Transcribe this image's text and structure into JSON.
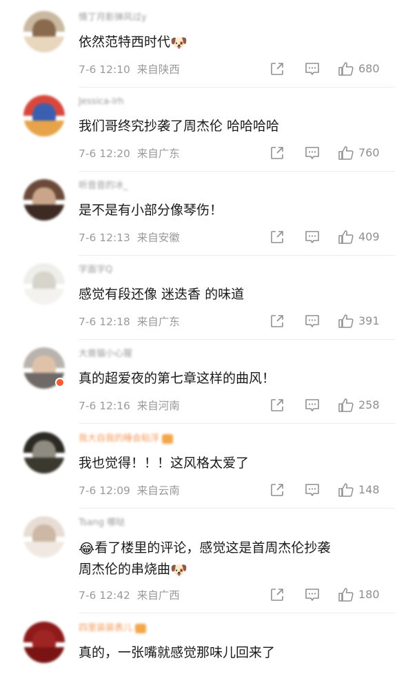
{
  "comments": [
    {
      "username": "情丁月影弹风过y",
      "text": "依然范特西时代",
      "emoji_after": "🐶",
      "time": "7-6 12:10",
      "location": "来自陕西",
      "likes": "680",
      "avatar_colors": [
        "#c9b9a0",
        "#8a6a4c",
        "#e8d6bd"
      ]
    },
    {
      "username": "Jessica-lrh",
      "text": "我们哥终究抄袭了周杰伦 哈哈哈哈",
      "time": "7-6 12:20",
      "location": "来自广东",
      "likes": "760",
      "avatar_colors": [
        "#d8473c",
        "#3a5fb0",
        "#e6a34a"
      ]
    },
    {
      "username": "听音音的冰_",
      "text": "是不是有小部分像琴伤！",
      "time": "7-6 12:13",
      "location": "来自安徽",
      "likes": "409",
      "avatar_colors": [
        "#6b4a3a",
        "#caa58a",
        "#3d2a22"
      ]
    },
    {
      "username": "字面字Q",
      "text": "感觉有段还像 迷迭香 的味道",
      "time": "7-6 12:18",
      "location": "来自广东",
      "likes": "391",
      "avatar_colors": [
        "#eeeeea",
        "#d7d4cc",
        "#f3f2ee"
      ]
    },
    {
      "username": "大兽猫小心猩",
      "text": "真的超爱夜的第七章这样的曲风！",
      "time": "7-6 12:16",
      "location": "来自河南",
      "likes": "258",
      "avatar_colors": [
        "#b9b3ae",
        "#e0c2a8",
        "#6f6a68"
      ]
    },
    {
      "username": "我大自我的睡会粘浮",
      "text": "我也觉得！！！这风格太爱了",
      "time": "7-6 12:09",
      "location": "来自云南",
      "likes": "148",
      "avatar_colors": [
        "#2c2a24",
        "#8f8b80",
        "#3a382f"
      ]
    },
    {
      "username": "Tsang 哪哒",
      "text_lines": [
        "看了楼里的评论，感觉这是首周杰伦抄袭",
        "周杰伦的串烧曲"
      ],
      "emoji_before": "😂",
      "emoji_after": "🐶",
      "time": "7-6 12:42",
      "location": "来自广西",
      "likes": "180",
      "avatar_colors": [
        "#e8ddd4",
        "#cdb8a6",
        "#f1e9e1"
      ]
    },
    {
      "username": "四里装装表儿",
      "text": "真的，一张嘴就感觉那味儿回来了",
      "avatar_colors": [
        "#8e1a1a",
        "#9f2424",
        "#7a1414"
      ]
    }
  ],
  "icons": {
    "share": "share-icon",
    "comment": "comment-icon",
    "like": "like-icon"
  }
}
